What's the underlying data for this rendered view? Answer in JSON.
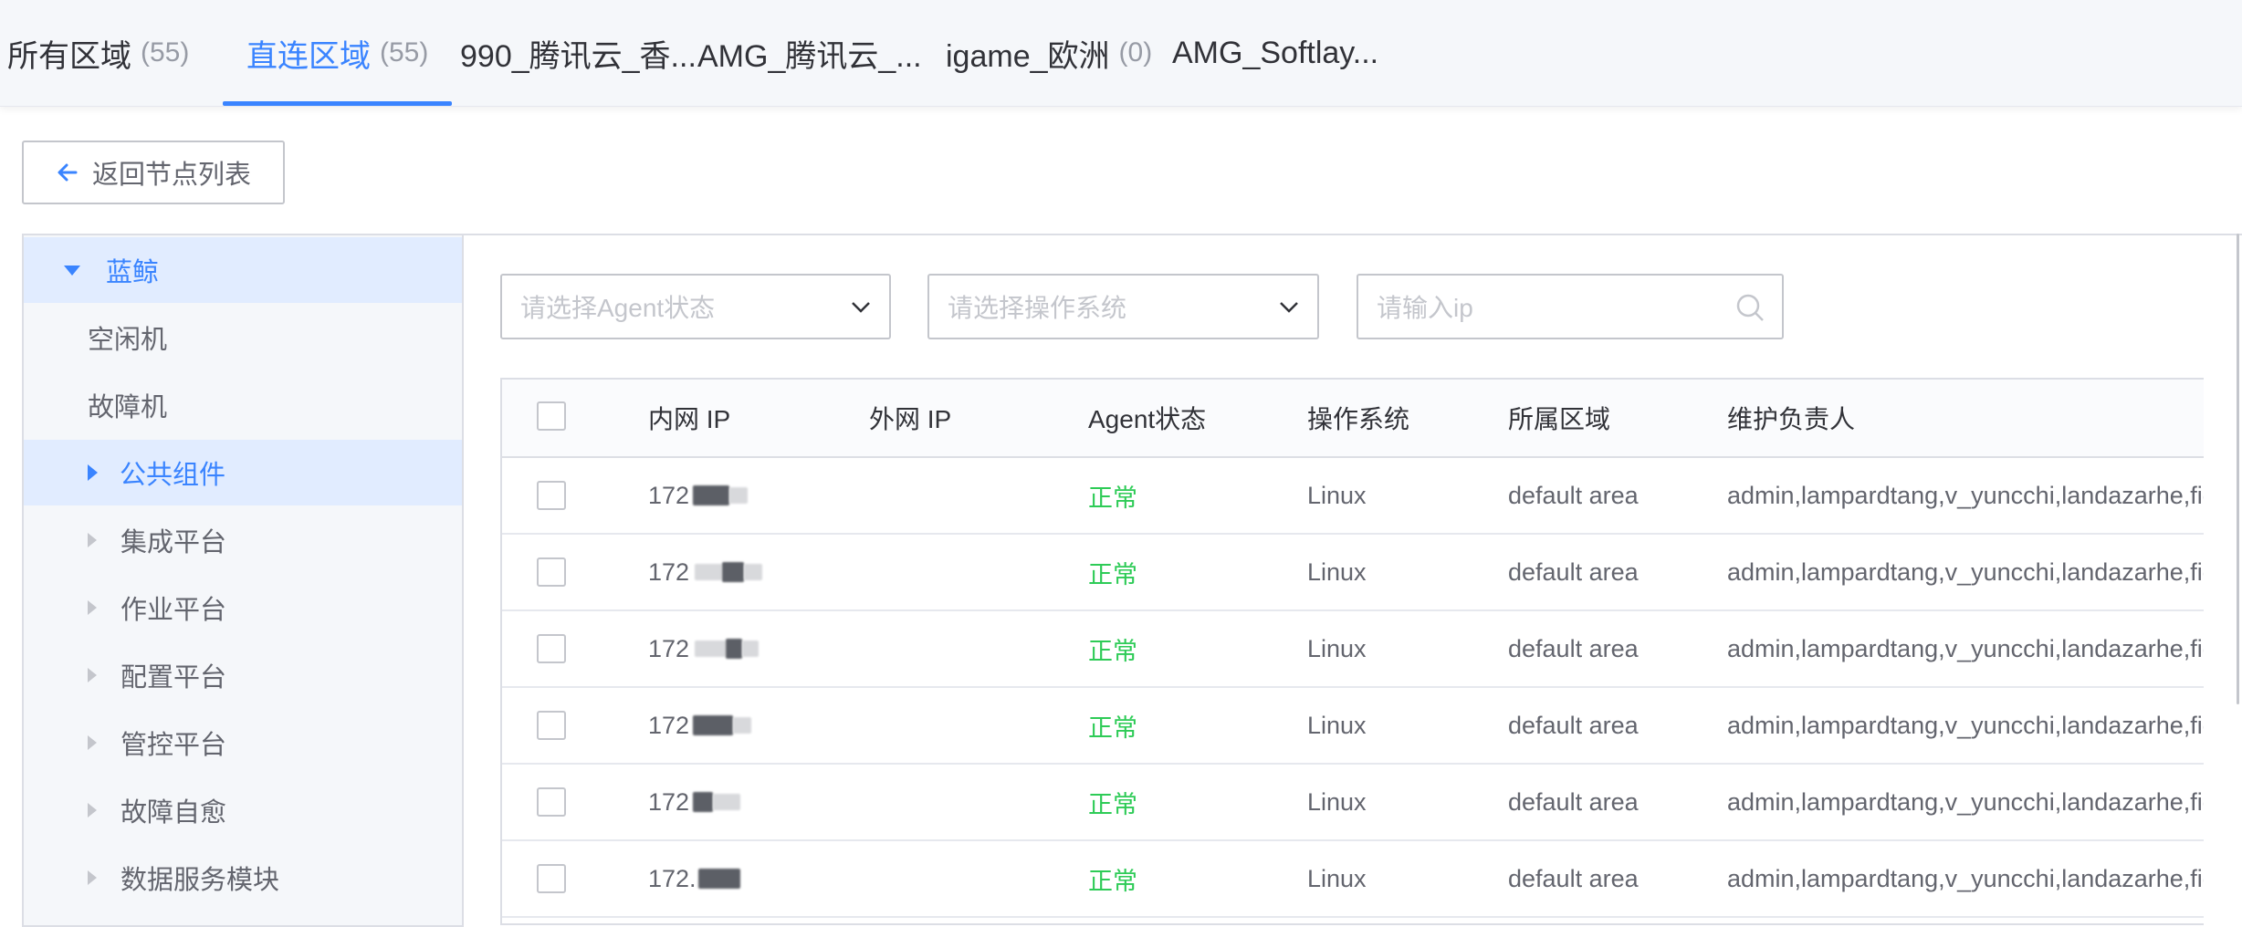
{
  "tabs": [
    {
      "label": "所有区域",
      "count": "(55)"
    },
    {
      "label": "直连区域",
      "count": "(55)"
    },
    {
      "label": "990_腾讯云_香...",
      "count": ""
    },
    {
      "label": "AMG_腾讯云_...",
      "count": ""
    },
    {
      "label": "igame_欧洲",
      "count": "(0)"
    },
    {
      "label": "AMG_Softlay...",
      "count": ""
    }
  ],
  "back_button": "返回节点列表",
  "sidebar": {
    "items": [
      {
        "label": "蓝鲸"
      },
      {
        "label": "空闲机"
      },
      {
        "label": "故障机"
      },
      {
        "label": "公共组件"
      },
      {
        "label": "集成平台"
      },
      {
        "label": "作业平台"
      },
      {
        "label": "配置平台"
      },
      {
        "label": "管控平台"
      },
      {
        "label": "故障自愈"
      },
      {
        "label": "数据服务模块"
      }
    ]
  },
  "filters": {
    "agent_status_placeholder": "请选择Agent状态",
    "os_placeholder": "请选择操作系统",
    "ip_placeholder": "请输入ip"
  },
  "table": {
    "headers": [
      "内网 IP",
      "外网 IP",
      "Agent状态",
      "操作系统",
      "所属区域",
      "维护负责人"
    ],
    "rows": [
      {
        "inner_ip": "172",
        "outer_ip": "",
        "status": "正常",
        "os": "Linux",
        "area": "default area",
        "owner": "admin,lampardtang,v_yuncchi,landazarhe,figh"
      },
      {
        "inner_ip": "172",
        "outer_ip": "",
        "status": "正常",
        "os": "Linux",
        "area": "default area",
        "owner": "admin,lampardtang,v_yuncchi,landazarhe,figh"
      },
      {
        "inner_ip": "172",
        "outer_ip": "",
        "status": "正常",
        "os": "Linux",
        "area": "default area",
        "owner": "admin,lampardtang,v_yuncchi,landazarhe,figh"
      },
      {
        "inner_ip": "172",
        "outer_ip": "",
        "status": "正常",
        "os": "Linux",
        "area": "default area",
        "owner": "admin,lampardtang,v_yuncchi,landazarhe,figh"
      },
      {
        "inner_ip": "172",
        "outer_ip": "",
        "status": "正常",
        "os": "Linux",
        "area": "default area",
        "owner": "admin,lampardtang,v_yuncchi,landazarhe,figh"
      },
      {
        "inner_ip": "172.",
        "outer_ip": "",
        "status": "正常",
        "os": "Linux",
        "area": "default area",
        "owner": "admin,lampardtang,v_yuncchi,landazarhe,figh"
      }
    ]
  },
  "colors": {
    "accent": "#3a84ff",
    "status_ok": "#2dcb56",
    "border": "#dcdee5"
  }
}
